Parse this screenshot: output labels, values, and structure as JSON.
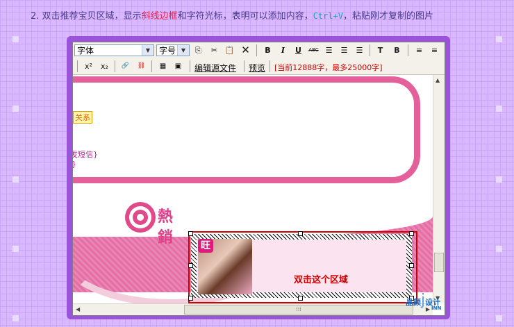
{
  "instruction": {
    "number": "2.",
    "part1": "双击推荐宝贝区域，显示",
    "highlight1": "斜线边框",
    "part2": "和字符光标，表明可以添加内容，",
    "shortcut": "Ctrl+V",
    "part3": "，粘贴刚才复制的图片"
  },
  "toolbar": {
    "font_select": "字体",
    "size_select": "字号",
    "bold": "B",
    "italic": "I",
    "underline": "U",
    "strike": "ABC",
    "superscript": "x²",
    "subscript": "x₂",
    "edit_source": "编辑源文件",
    "preview": "预览",
    "char_count": "[当前12888字，最多25000字]"
  },
  "content": {
    "left_text_1": "关系",
    "left_text_2": "发短信}",
    "left_text_3": "}",
    "hot_text": "熱銷",
    "badge_text": "旺",
    "double_click_text": "双击这个区域"
  },
  "logo": {
    "name": "晶颜",
    "design": "设计",
    "inn": "INN"
  }
}
